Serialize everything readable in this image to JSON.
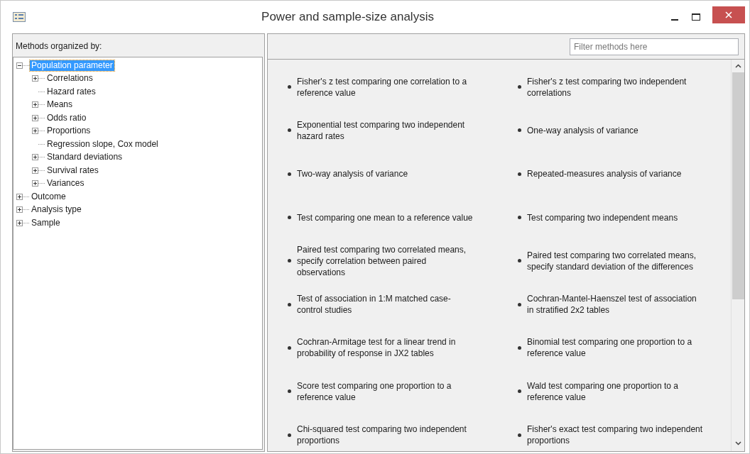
{
  "window": {
    "title": "Power and sample-size analysis"
  },
  "sidebar": {
    "heading": "Methods organized by:",
    "tree": [
      {
        "label": "Population parameter",
        "kind": "branch",
        "expanded": true,
        "selected": true,
        "children": [
          {
            "label": "Correlations",
            "kind": "branch",
            "expanded": false,
            "selected": false
          },
          {
            "label": "Hazard rates",
            "kind": "leaf",
            "selected": false
          },
          {
            "label": "Means",
            "kind": "branch",
            "expanded": false,
            "selected": false
          },
          {
            "label": "Odds ratio",
            "kind": "branch",
            "expanded": false,
            "selected": false
          },
          {
            "label": "Proportions",
            "kind": "branch",
            "expanded": false,
            "selected": false
          },
          {
            "label": "Regression slope, Cox model",
            "kind": "leaf",
            "selected": false
          },
          {
            "label": "Standard deviations",
            "kind": "branch",
            "expanded": false,
            "selected": false
          },
          {
            "label": "Survival rates",
            "kind": "branch",
            "expanded": false,
            "selected": false
          },
          {
            "label": "Variances",
            "kind": "branch",
            "expanded": false,
            "selected": false
          }
        ]
      },
      {
        "label": "Outcome",
        "kind": "branch",
        "expanded": false,
        "selected": false
      },
      {
        "label": "Analysis type",
        "kind": "branch",
        "expanded": false,
        "selected": false
      },
      {
        "label": "Sample",
        "kind": "branch",
        "expanded": false,
        "selected": false
      }
    ]
  },
  "filter": {
    "placeholder": "Filter methods here"
  },
  "methods": [
    "Fisher's z test comparing one correlation to a reference value",
    "Fisher's z test comparing two independent correlations",
    "Exponential test comparing two independent hazard rates",
    "One-way analysis of variance",
    "Two-way analysis of variance",
    "Repeated-measures analysis of variance",
    "Test comparing one mean to a reference value",
    "Test comparing two independent means",
    "Paired test comparing two correlated means, specify correlation between paired observations",
    "Paired test comparing two correlated means, specify standard deviation of the differences",
    "Test of association in 1:M matched case-control studies",
    "Cochran-Mantel-Haenszel test of association in stratified 2x2 tables",
    "Cochran-Armitage test for a linear trend in probability of response in JX2 tables",
    "Binomial test comparing one proportion to a reference value",
    "Score test comparing one proportion to a reference value",
    "Wald test comparing one proportion to a reference value",
    "Chi-squared test comparing two independent proportions",
    "Fisher's exact test comparing two independent proportions"
  ]
}
